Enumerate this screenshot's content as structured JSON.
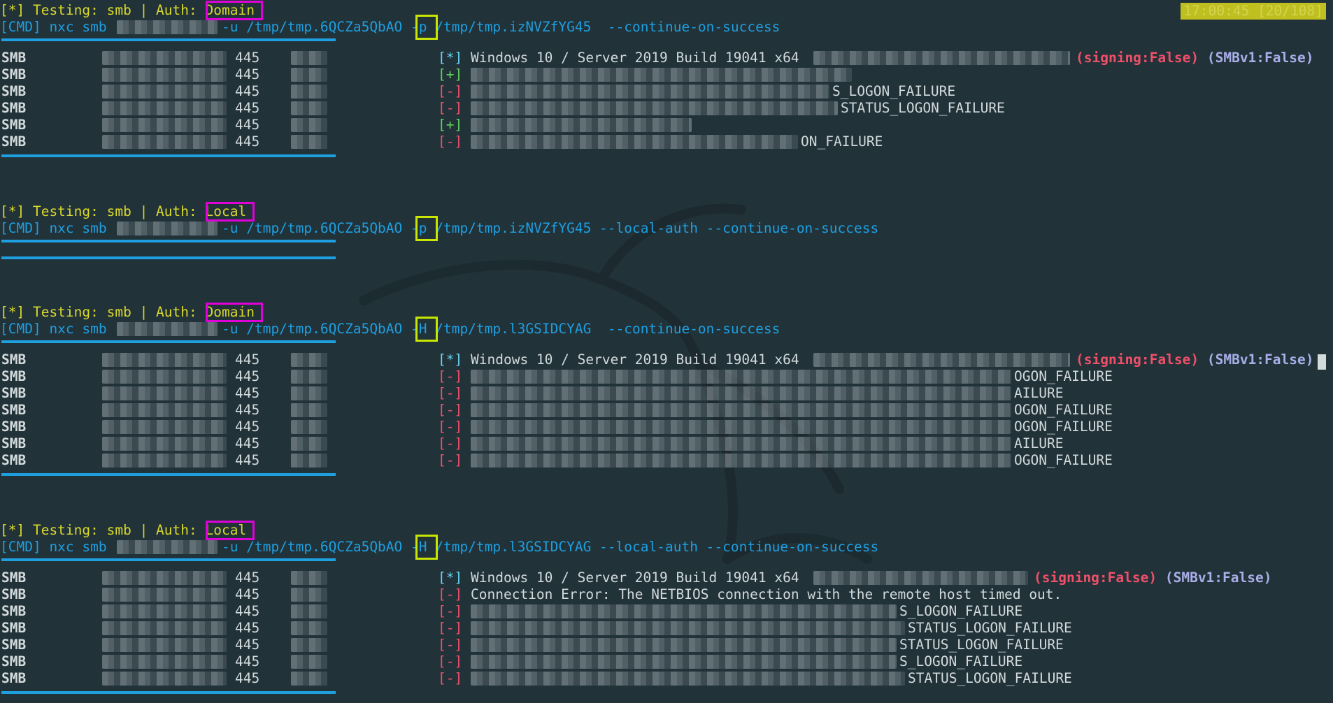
{
  "status_bar": "17:00:45 [20/108]",
  "blocks": [
    {
      "header": {
        "prefix": "[*] Testing: smb | Auth: ",
        "auth": "Domain"
      },
      "cmd": {
        "prefix": "[CMD] nxc smb ",
        "user": "-u /tmp/tmp.6QCZa5QbAO ",
        "flag": "-p",
        "rest": " /tmp/tmp.izNVZfYG45  --continue-on-success"
      },
      "rows": [
        {
          "proto": "SMB",
          "port": "445",
          "mark": "[*]",
          "msg": "Windows 10 / Server 2019 Build 19041 x64",
          "signing": "(signing:False)",
          "smbv1": "(SMBv1:False)"
        },
        {
          "proto": "SMB",
          "port": "445",
          "mark": "[+]",
          "msg": ""
        },
        {
          "proto": "SMB",
          "port": "445",
          "mark": "[-]",
          "msg": "S_LOGON_FAILURE"
        },
        {
          "proto": "SMB",
          "port": "445",
          "mark": "[-]",
          "msg": "STATUS_LOGON_FAILURE"
        },
        {
          "proto": "SMB",
          "port": "445",
          "mark": "[+]",
          "msg": ""
        },
        {
          "proto": "SMB",
          "port": "445",
          "mark": "[-]",
          "msg": "ON_FAILURE"
        }
      ]
    },
    {
      "header": {
        "prefix": "[*] Testing: smb | Auth: ",
        "auth": "Local"
      },
      "cmd": {
        "prefix": "[CMD] nxc smb ",
        "user": "-u /tmp/tmp.6QCZa5QbAO ",
        "flag": "-p",
        "rest": " /tmp/tmp.izNVZfYG45 --local-auth --continue-on-success"
      },
      "rows": []
    },
    {
      "header": {
        "prefix": "[*] Testing: smb | Auth: ",
        "auth": "Domain"
      },
      "cmd": {
        "prefix": "[CMD] nxc smb ",
        "user": "-u /tmp/tmp.6QCZa5QbAO ",
        "flag": "-H",
        "rest": " /tmp/tmp.l3GSIDCYAG  --continue-on-success"
      },
      "rows": [
        {
          "proto": "SMB",
          "port": "445",
          "mark": "[*]",
          "msg": "Windows 10 / Server 2019 Build 19041 x64",
          "signing": "(signing:False)",
          "smbv1": "(SMBv1:False)"
        },
        {
          "proto": "SMB",
          "port": "445",
          "mark": "[-]",
          "msg": "OGON_FAILURE"
        },
        {
          "proto": "SMB",
          "port": "445",
          "mark": "[-]",
          "msg": "AILURE"
        },
        {
          "proto": "SMB",
          "port": "445",
          "mark": "[-]",
          "msg": "OGON_FAILURE"
        },
        {
          "proto": "SMB",
          "port": "445",
          "mark": "[-]",
          "msg": "OGON_FAILURE"
        },
        {
          "proto": "SMB",
          "port": "445",
          "mark": "[-]",
          "msg": "AILURE"
        },
        {
          "proto": "SMB",
          "port": "445",
          "mark": "[-]",
          "msg": "OGON_FAILURE"
        }
      ]
    },
    {
      "header": {
        "prefix": "[*] Testing: smb | Auth: ",
        "auth": "Local"
      },
      "cmd": {
        "prefix": "[CMD] nxc smb ",
        "user": "-u /tmp/tmp.6QCZa5QbAO ",
        "flag": "-H",
        "rest": " /tmp/tmp.l3GSIDCYAG --local-auth --continue-on-success"
      },
      "rows": [
        {
          "proto": "SMB",
          "port": "445",
          "mark": "[*]",
          "msg": "Windows 10 / Server 2019 Build 19041 x64",
          "signing": "(signing:False)",
          "smbv1": "(SMBv1:False)"
        },
        {
          "proto": "SMB",
          "port": "445",
          "mark": "[-]",
          "msg": "Connection Error: The NETBIOS connection with the remote host timed out."
        },
        {
          "proto": "SMB",
          "port": "445",
          "mark": "[-]",
          "msg": "S_LOGON_FAILURE"
        },
        {
          "proto": "SMB",
          "port": "445",
          "mark": "[-]",
          "msg": "STATUS_LOGON_FAILURE"
        },
        {
          "proto": "SMB",
          "port": "445",
          "mark": "[-]",
          "msg": "STATUS_LOGON_FAILURE"
        },
        {
          "proto": "SMB",
          "port": "445",
          "mark": "[-]",
          "msg": "S_LOGON_FAILURE"
        },
        {
          "proto": "SMB",
          "port": "445",
          "mark": "[-]",
          "msg": "STATUS_LOGON_FAILURE"
        }
      ]
    }
  ]
}
